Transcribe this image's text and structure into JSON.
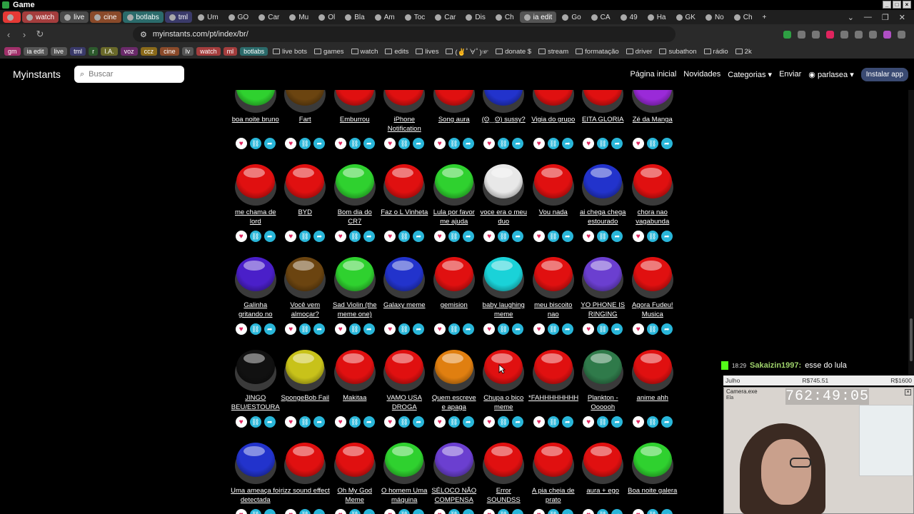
{
  "window": {
    "title": "Game"
  },
  "tabs": [
    {
      "label": "",
      "color": "#e53935"
    },
    {
      "label": "watch",
      "color": "#a43d3d"
    },
    {
      "label": "live",
      "color": "#4a4a4a"
    },
    {
      "label": "cine",
      "color": "#8a4a2a"
    },
    {
      "label": "botlabs",
      "color": "#2b6b6b"
    },
    {
      "label": "tml",
      "color": "#3a3a6a"
    },
    {
      "label": "Um",
      "color": ""
    },
    {
      "label": "GO",
      "color": ""
    },
    {
      "label": "Car",
      "color": ""
    },
    {
      "label": "Mu",
      "color": ""
    },
    {
      "label": "Ol",
      "color": ""
    },
    {
      "label": "Bla",
      "color": ""
    },
    {
      "label": "Am",
      "color": ""
    },
    {
      "label": "Toc",
      "color": ""
    },
    {
      "label": "Car",
      "color": ""
    },
    {
      "label": "Dis",
      "color": ""
    },
    {
      "label": "Ch",
      "color": ""
    },
    {
      "label": "ia edit",
      "color": "#555"
    },
    {
      "label": "Go",
      "color": ""
    },
    {
      "label": "CA",
      "color": ""
    },
    {
      "label": "49",
      "color": ""
    },
    {
      "label": "Ha",
      "color": ""
    },
    {
      "label": "GK",
      "color": ""
    },
    {
      "label": "No",
      "color": ""
    },
    {
      "label": "Ch",
      "color": ""
    }
  ],
  "address": {
    "url": "myinstants.com/pt/index/br/"
  },
  "bookmarks": {
    "chips": [
      {
        "label": "gm",
        "color": "#a0306a"
      },
      {
        "label": "ia edit",
        "color": "#555555"
      },
      {
        "label": "live",
        "color": "#555555"
      },
      {
        "label": "tml",
        "color": "#3a3a6a"
      },
      {
        "label": "r",
        "color": "#2d5a2d"
      },
      {
        "label": "I.A.",
        "color": "#6a6a2a"
      },
      {
        "label": "voz",
        "color": "#6a2a6a"
      },
      {
        "label": "ccz",
        "color": "#8a6a1a"
      },
      {
        "label": "cine",
        "color": "#8a4a2a"
      },
      {
        "label": "lv",
        "color": "#555555"
      },
      {
        "label": "watch",
        "color": "#a43d3d"
      },
      {
        "label": "ml",
        "color": "#a43d3d"
      },
      {
        "label": "botlabs",
        "color": "#2b6b6b"
      }
    ],
    "folders": [
      "live bots",
      "games",
      "watch",
      "edits",
      "lives",
      "(✌ﾟ∀ﾟ)☞",
      "donate $",
      "stream",
      "formatação",
      "driver",
      "subathon",
      "rádio",
      "2k"
    ]
  },
  "site": {
    "brand": "Myinstants",
    "search_placeholder": "Buscar",
    "nav": {
      "home": "Página inicial",
      "news": "Novidades",
      "categories": "Categorias",
      "upload": "Enviar",
      "user": "parlasea",
      "install": "Instalar app"
    }
  },
  "sounds": [
    [
      {
        "label": "boa noite bruno",
        "color": "green"
      },
      {
        "label": "Fart",
        "color": "brown"
      },
      {
        "label": "Emburrou",
        "color": "red"
      },
      {
        "label": "iPhone Notification",
        "color": "red"
      },
      {
        "label": "Song aura",
        "color": "red"
      },
      {
        "label": "(ʘ‿ʘ) sussy?",
        "color": "blue"
      },
      {
        "label": "Vigia do grupo",
        "color": "red"
      },
      {
        "label": "EITA GLORIA",
        "color": "red"
      },
      {
        "label": "Zé da Manga",
        "color": "purple"
      }
    ],
    [
      {
        "label": "me chama de lord",
        "color": "red"
      },
      {
        "label": "BYD",
        "color": "red"
      },
      {
        "label": "Bom dia do CR7",
        "color": "green"
      },
      {
        "label": "Faz o L Vinheta",
        "color": "red"
      },
      {
        "label": "Lula por favor me ajuda",
        "color": "green"
      },
      {
        "label": "voce era o meu duo",
        "color": "white"
      },
      {
        "label": "Vou nada",
        "color": "red"
      },
      {
        "label": "ai chega chega estourado",
        "color": "blue"
      },
      {
        "label": "chora nao vagabunda",
        "color": "red"
      }
    ],
    [
      {
        "label": "Galinha gritando no",
        "color": "indigo"
      },
      {
        "label": "Você vem almoçar?",
        "color": "brown"
      },
      {
        "label": "Sad Violin (the meme one)",
        "color": "green"
      },
      {
        "label": "Galaxy meme",
        "color": "blue"
      },
      {
        "label": "gemision",
        "color": "red"
      },
      {
        "label": "baby laughing meme",
        "color": "cyan"
      },
      {
        "label": "meu biscoito nao",
        "color": "red"
      },
      {
        "label": "YO PHONE IS RINGING",
        "color": "violet"
      },
      {
        "label": "Agora Fudeu! Musica",
        "color": "red"
      }
    ],
    [
      {
        "label": "JINGO BEU/ESTOURA",
        "color": "black"
      },
      {
        "label": "SpongeBob Fail",
        "color": "yellow"
      },
      {
        "label": "Makitaa",
        "color": "red"
      },
      {
        "label": "VAMO USA DROGA",
        "color": "red"
      },
      {
        "label": "Quem escreve e apaga",
        "color": "orange"
      },
      {
        "label": "Chupa o bico meme",
        "color": "red"
      },
      {
        "label": "*FAHHHHHHHHHHHHHHH",
        "color": "red"
      },
      {
        "label": "Plankton - Oooooh",
        "color": "darkgreen"
      },
      {
        "label": "anime ahh",
        "color": "red"
      }
    ],
    [
      {
        "label": "Uma ameaça foi detectada",
        "color": "blue"
      },
      {
        "label": "rizz sound effect",
        "color": "red"
      },
      {
        "label": "Oh My God Meme",
        "color": "red"
      },
      {
        "label": "O homem Uma máquina",
        "color": "green"
      },
      {
        "label": "SÉLOCO NÃO COMPENSA",
        "color": "violet"
      },
      {
        "label": "Error SOUNDSS",
        "color": "red"
      },
      {
        "label": "A pia cheia de prato",
        "color": "red"
      },
      {
        "label": "aura + ego",
        "color": "red"
      },
      {
        "label": "Boa noite galera",
        "color": "green"
      }
    ]
  ],
  "palette": {
    "red": "#e01010",
    "green": "#2fd12f",
    "brown": "#6b4410",
    "blue": "#2233cc",
    "purple": "#9a2ad8",
    "white": "#e8e8e8",
    "indigo": "#4a1fc9",
    "cyan": "#1ad2d8",
    "violet": "#6b3fd0",
    "black": "#111111",
    "yellow": "#c8c21a",
    "orange": "#e07f10",
    "darkgreen": "#2f7a4a"
  },
  "overlay": {
    "chat_time": "18:29",
    "chat_user": "Sakaizin1997:",
    "chat_message": "esse do lula",
    "goal_month": "Julho",
    "goal_current": "R$745.51",
    "goal_target": "R$1600",
    "camera_title": "Camera.exe",
    "camera_sub": "Ela",
    "timer": "762:49:05"
  }
}
